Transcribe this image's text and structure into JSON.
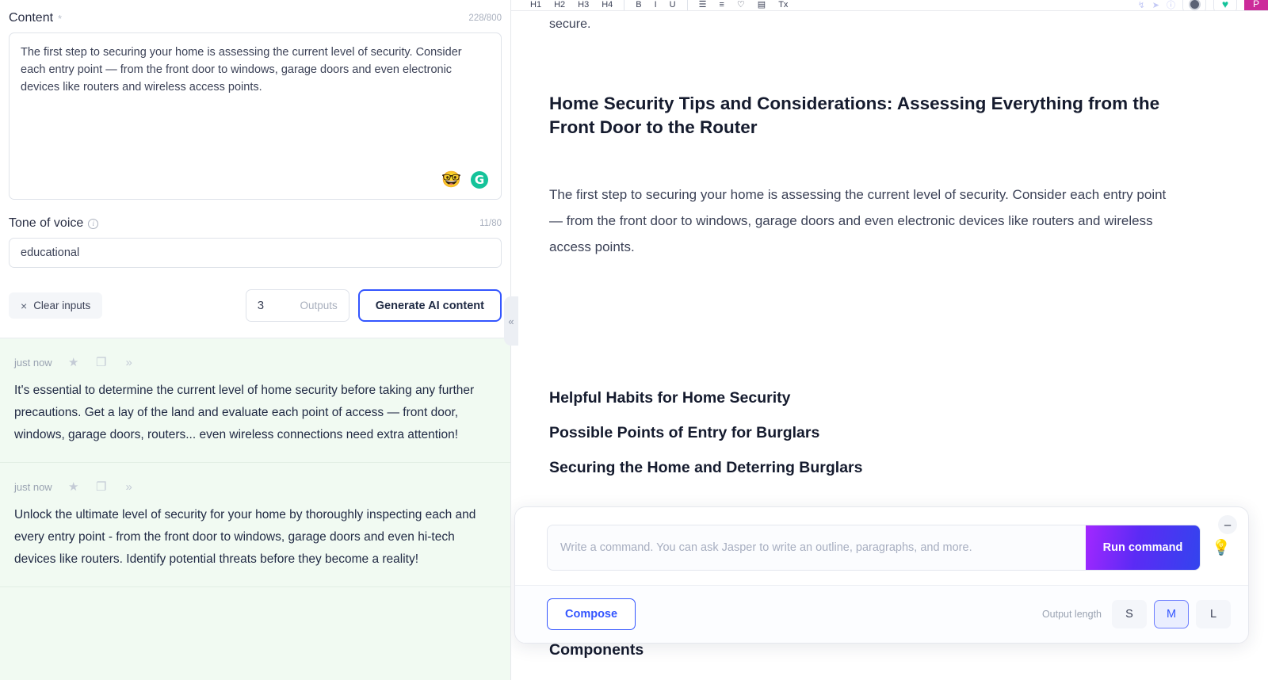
{
  "left_panel": {
    "content_field": {
      "label": "Content",
      "required_mark": "*",
      "char_count": "228/800",
      "value": "The first step to securing your home is assessing the current level of security. Consider each entry point — from the front door to windows, garage doors and even electronic devices like routers and wireless access points.",
      "nerd_emoji": "🤓",
      "grammarly_letter": "G"
    },
    "tone_field": {
      "label": "Tone of voice",
      "info_glyph": "i",
      "char_count": "11/80",
      "value": "educational",
      "placeholder": "Tone of voice"
    },
    "actions": {
      "clear_label": "Clear inputs",
      "clear_icon": "×",
      "outputs_value": "3",
      "outputs_label": "Outputs",
      "generate_label": "Generate AI content"
    },
    "outputs": [
      {
        "time": "just now",
        "star_icon": "★",
        "copy_icon": "❐",
        "insert_icon": "»",
        "text": "It's essential to determine the current level of home security before taking any further precautions. Get a lay of the land and evaluate each point of access — front door, windows, garage doors, routers... even wireless connections need extra attention!"
      },
      {
        "time": "just now",
        "star_icon": "★",
        "copy_icon": "❐",
        "insert_icon": "»",
        "text": "Unlock the ultimate level of security for your home by thoroughly inspecting each and every entry point - from the front door to windows, garage doors and even hi-tech devices like routers. Identify potential threats before they become a reality!"
      }
    ]
  },
  "collapse_handle": {
    "glyph": "«"
  },
  "toolbar": {
    "heading_buttons": [
      "H1",
      "H2",
      "H3",
      "H4"
    ],
    "format_buttons": [
      "B",
      "I",
      "U"
    ],
    "list_buttons": [
      "☰",
      "≡"
    ],
    "extra_buttons": [
      "♡",
      "▤",
      "Tx"
    ],
    "right_icons": [
      "↯",
      "➤",
      "ⓘ"
    ],
    "avatar_letter": "P"
  },
  "document": {
    "partial_line": "secure.",
    "title": "Home Security Tips and Considerations: Assessing Everything from the Front Door to the Router",
    "paragraph": "The first step to securing your home is assessing the current level of security. Consider each entry point — from the front door to windows, garage doors and even electronic devices like routers and wireless access points.",
    "headings": [
      "Helpful Habits for Home Security",
      "Possible Points of Entry for Burglars",
      "Securing the Home and Deterring Burglars"
    ],
    "bottom_heading": "Components"
  },
  "command_bar": {
    "placeholder": "Write a command. You can ask Jasper to write an outline, paragraphs, and more.",
    "value": "",
    "run_label": "Run command",
    "bulb_icon": "💡",
    "minimize_glyph": "–",
    "compose_label": "Compose",
    "output_length_label": "Output length",
    "length_options": [
      "S",
      "M",
      "L"
    ],
    "length_selected": "M"
  },
  "colors": {
    "accent_blue": "#3355ff",
    "grammarly_green": "#15c39a",
    "output_bg": "#f1faf2",
    "run_gradient_start": "#a327ff",
    "run_gradient_end": "#3344ee",
    "avatar_pink": "#cc2a9a"
  }
}
